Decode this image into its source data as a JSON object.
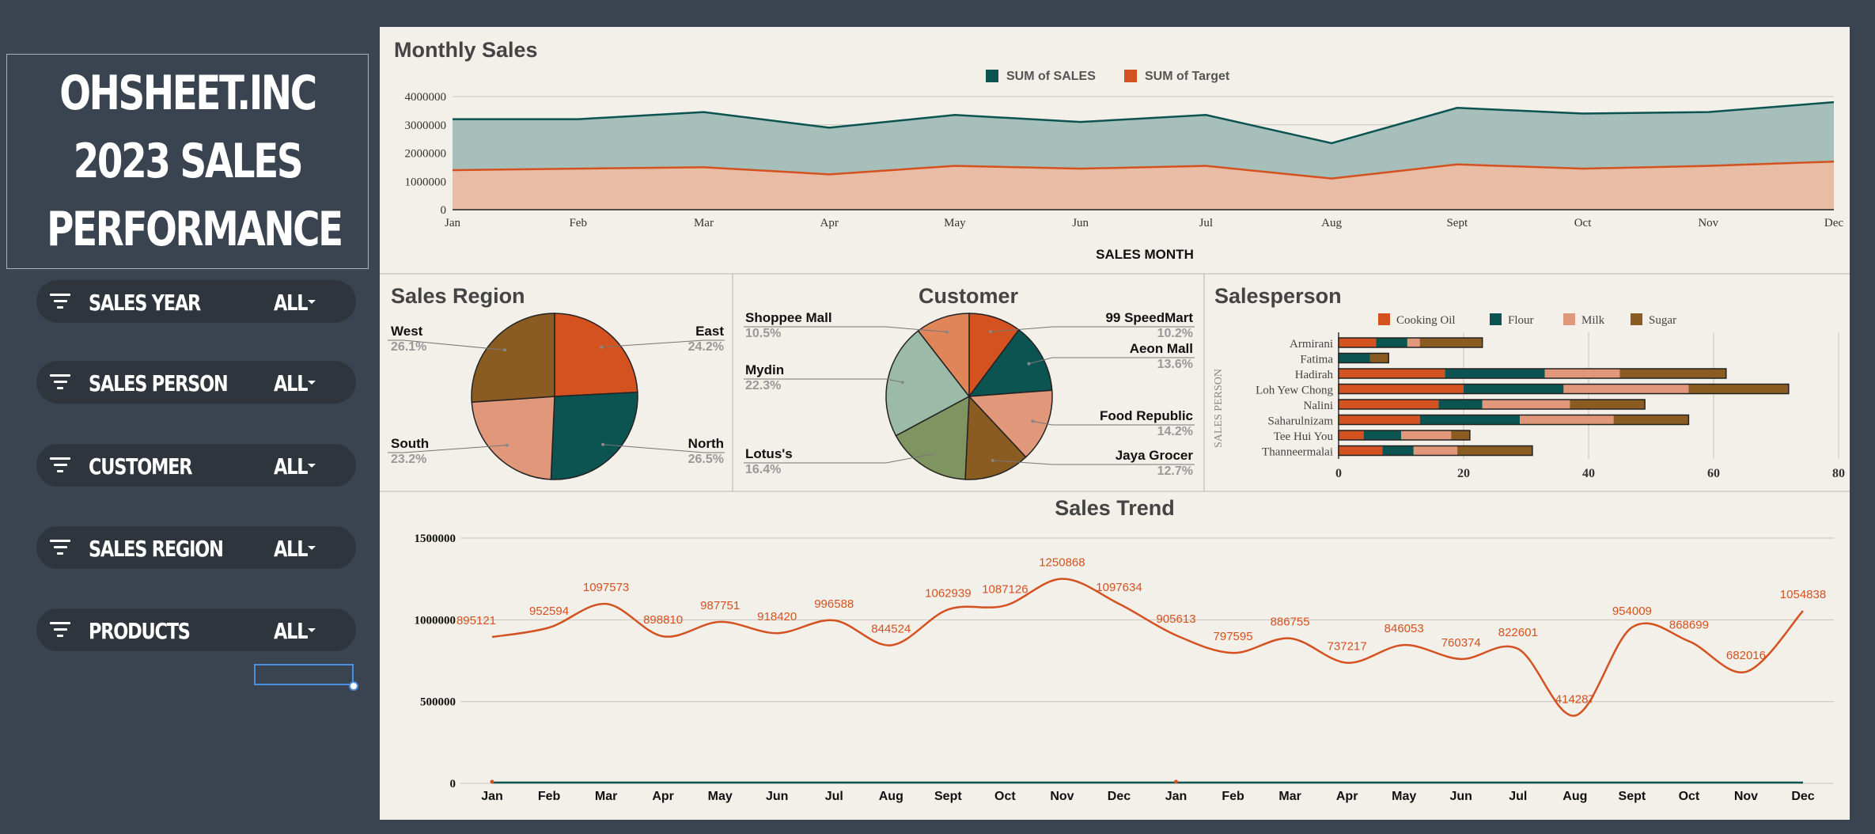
{
  "sidebar": {
    "title_lines": [
      "OHSHEET.INC",
      "2023 SALES",
      "PERFORMANCE"
    ],
    "filters": [
      {
        "label": "SALES YEAR",
        "value": "ALL"
      },
      {
        "label": "SALES PERSON",
        "value": "ALL"
      },
      {
        "label": "CUSTOMER",
        "value": "ALL"
      },
      {
        "label": "SALES REGION",
        "value": "ALL"
      },
      {
        "label": "PRODUCTS",
        "value": "ALL"
      }
    ]
  },
  "colors": {
    "orange": "#d35220",
    "teal": "#0c5451",
    "salmon": "#e0977a",
    "brown": "#8a5c22",
    "sage": "#9bbaa8",
    "olive": "#7f9460",
    "light_orange": "#e0845a"
  },
  "chart_data": [
    {
      "type": "area",
      "title": "Monthly Sales",
      "xlabel": "SALES MONTH",
      "ylabel": "",
      "categories": [
        "Jan",
        "Feb",
        "Mar",
        "Apr",
        "May",
        "Jun",
        "Jul",
        "Aug",
        "Sept",
        "Oct",
        "Nov",
        "Dec"
      ],
      "ylim": [
        0,
        4000000
      ],
      "yticks": [
        "4000000",
        "3000000",
        "2000000",
        "1000000",
        "0"
      ],
      "legend_position": "top-center",
      "grid": true,
      "series": [
        {
          "name": "SUM of SALES",
          "color": "#0c5451",
          "values": [
            3200000,
            3200000,
            3450000,
            2900000,
            3350000,
            3100000,
            3350000,
            2350000,
            3600000,
            3400000,
            3450000,
            3800000
          ]
        },
        {
          "name": "SUM of Target",
          "color": "#d35220",
          "values": [
            1400000,
            1450000,
            1500000,
            1250000,
            1550000,
            1450000,
            1550000,
            1100000,
            1600000,
            1450000,
            1550000,
            1700000
          ]
        }
      ]
    },
    {
      "type": "pie",
      "title": "Sales Region",
      "slices": [
        {
          "label": "East",
          "value": 24.2,
          "pct": "24.2%",
          "color": "#d35220"
        },
        {
          "label": "North",
          "value": 26.5,
          "pct": "26.5%",
          "color": "#0c5451"
        },
        {
          "label": "South",
          "value": 23.2,
          "pct": "23.2%",
          "color": "#e0977a"
        },
        {
          "label": "West",
          "value": 26.1,
          "pct": "26.1%",
          "color": "#8a5c22"
        }
      ]
    },
    {
      "type": "pie",
      "title": "Customer",
      "slices": [
        {
          "label": "99 SpeedMart",
          "value": 10.2,
          "pct": "10.2%",
          "color": "#d35220"
        },
        {
          "label": "Aeon Mall",
          "value": 13.6,
          "pct": "13.6%",
          "color": "#0c5451"
        },
        {
          "label": "Food Republic",
          "value": 14.2,
          "pct": "14.2%",
          "color": "#e0977a"
        },
        {
          "label": "Jaya Grocer",
          "value": 12.7,
          "pct": "12.7%",
          "color": "#8a5c22"
        },
        {
          "label": "Lotus's",
          "value": 16.4,
          "pct": "16.4%",
          "color": "#7f9460"
        },
        {
          "label": "Mydin",
          "value": 22.3,
          "pct": "22.3%",
          "color": "#9bbaa8"
        },
        {
          "label": "Shoppee Mall",
          "value": 10.5,
          "pct": "10.5%",
          "color": "#e0845a"
        }
      ]
    },
    {
      "type": "bar",
      "orientation": "horizontal",
      "stacked": true,
      "title": "Salesperson",
      "ylabel": "SALES PERSON",
      "xlim": [
        0,
        80
      ],
      "xticks": [
        "0",
        "20",
        "40",
        "60",
        "80"
      ],
      "legend_position": "top",
      "categories": [
        "Armirani",
        "Fatima",
        "Hadirah",
        "Loh Yew Chong",
        "Nalini",
        "Saharulnizam",
        "Tee Hui You",
        "Thanneermalai"
      ],
      "series": [
        {
          "name": "Cooking Oil",
          "color": "#d35220",
          "values": [
            6,
            0,
            17,
            20,
            16,
            13,
            4,
            7
          ]
        },
        {
          "name": "Flour",
          "color": "#0c5451",
          "values": [
            5,
            5,
            16,
            16,
            7,
            16,
            6,
            5
          ]
        },
        {
          "name": "Milk",
          "color": "#e0977a",
          "values": [
            2,
            0,
            12,
            20,
            14,
            15,
            8,
            7
          ]
        },
        {
          "name": "Sugar",
          "color": "#8a5c22",
          "values": [
            10,
            3,
            17,
            16,
            12,
            12,
            3,
            12
          ]
        }
      ]
    },
    {
      "type": "line",
      "title": "Sales Trend",
      "categories": [
        "Jan",
        "Feb",
        "Mar",
        "Apr",
        "May",
        "Jun",
        "Jul",
        "Aug",
        "Sept",
        "Oct",
        "Nov",
        "Dec",
        "Jan",
        "Feb",
        "Mar",
        "Apr",
        "May",
        "Jun",
        "Jul",
        "Aug",
        "Sept",
        "Oct",
        "Nov",
        "Dec"
      ],
      "ylim": [
        0,
        1500000
      ],
      "yticks": [
        "1500000",
        "1000000",
        "500000",
        "0"
      ],
      "grid": true,
      "series": [
        {
          "color": "#d35220",
          "values": [
            895121,
            952594,
            1097573,
            898810,
            987751,
            918420,
            996588,
            844524,
            1062939,
            1087126,
            1250868,
            1097634,
            905613,
            797595,
            886755,
            737217,
            846053,
            760374,
            822601,
            414287,
            954009,
            868699,
            682016,
            1054838
          ]
        }
      ]
    }
  ]
}
